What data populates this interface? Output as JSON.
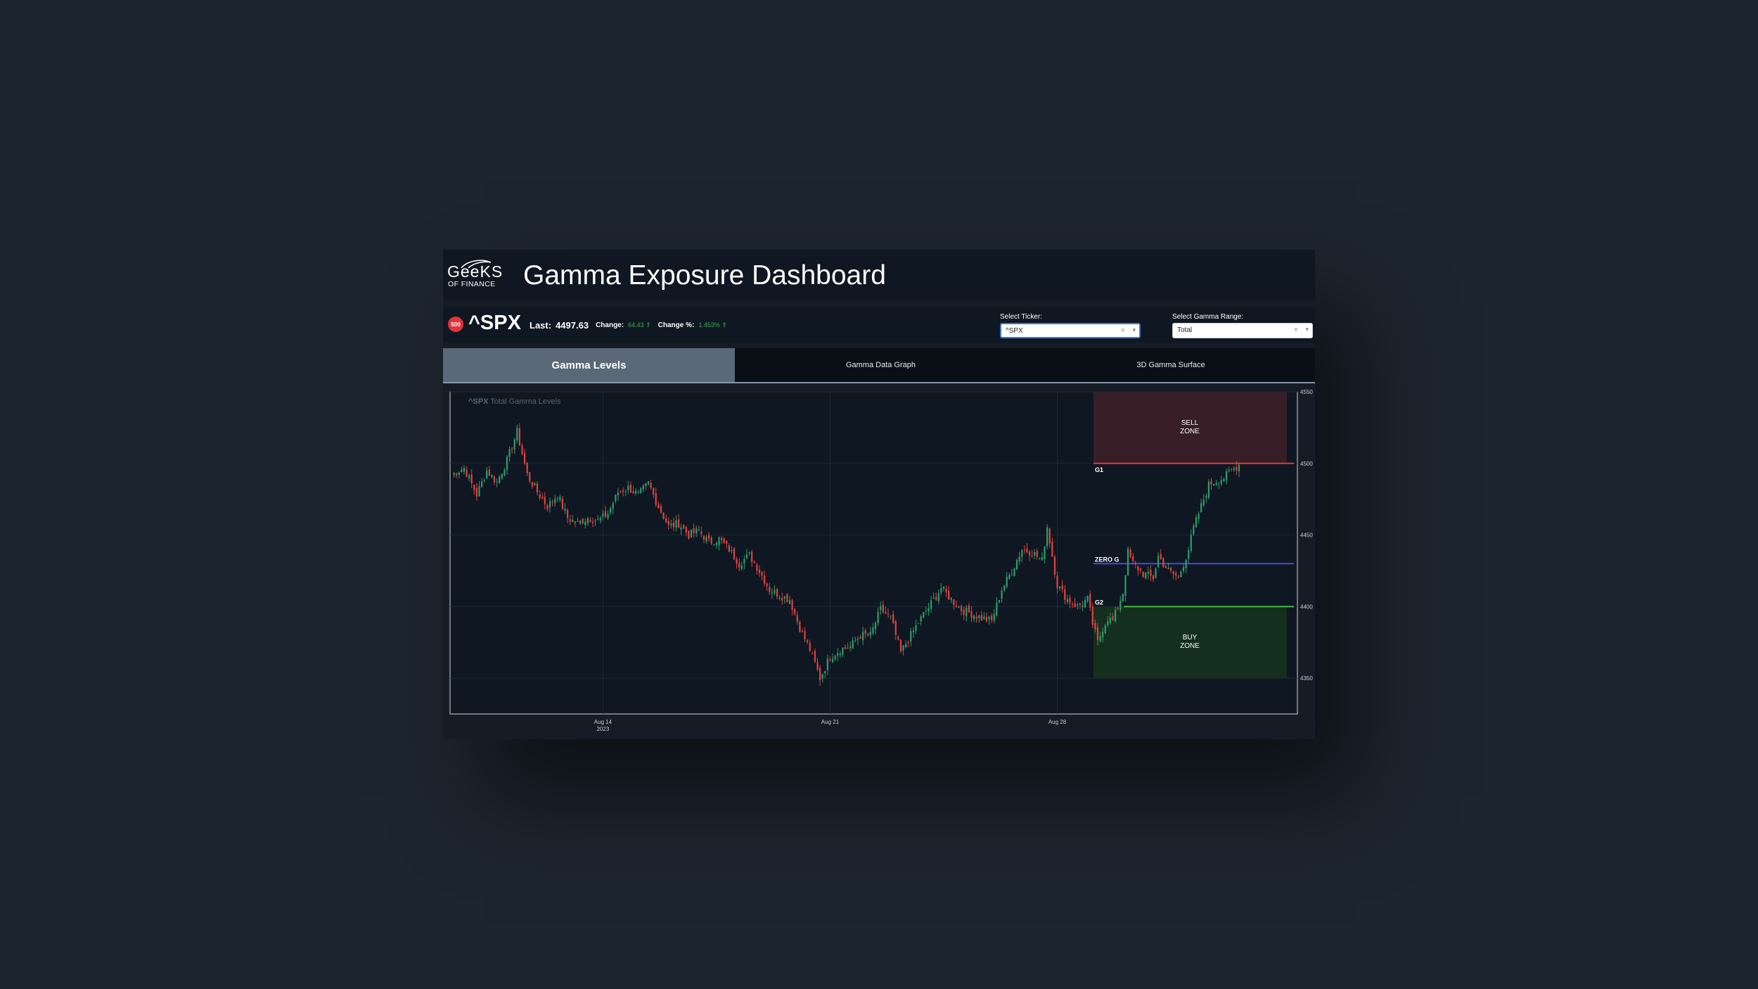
{
  "app": {
    "title": "Gamma Exposure Dashboard",
    "logo": {
      "main": "GeeKS",
      "sub": "OF FINANCE"
    }
  },
  "quote": {
    "badge": "500",
    "ticker": "^SPX",
    "last_label": "Last:",
    "last_value": "4497.63",
    "change_label": "Change:",
    "change_value": "64.43 ⇑",
    "change_pct_label": "Change %:",
    "change_pct_value": "1.453% ⇑",
    "positive_color": "#2db84d"
  },
  "controls": {
    "ticker_label": "Select Ticker:",
    "ticker_value": "^SPX",
    "gamma_label": "Select Gamma Range:",
    "gamma_value": "Total"
  },
  "tabs": [
    {
      "label": "Gamma Levels",
      "active": true
    },
    {
      "label": "Gamma Data Graph",
      "active": false
    },
    {
      "label": "3D Gamma Surface",
      "active": false
    }
  ],
  "chart_data": {
    "type": "candlestick",
    "title_bold": "^SPX",
    "title_rest": "Total Gamma Levels",
    "ylim": [
      4325,
      4550
    ],
    "y_ticks": [
      4350,
      4400,
      4450,
      4500,
      4550
    ],
    "x_ticks": [
      {
        "label": "Aug 14",
        "sub": "2023",
        "index": 60
      },
      {
        "label": "Aug 21",
        "sub": "",
        "index": 150
      },
      {
        "label": "Aug 28",
        "sub": "",
        "index": 240
      }
    ],
    "levels": [
      {
        "name": "G1",
        "value": 4500,
        "color": "#e03a3a"
      },
      {
        "name": "ZERO G",
        "value": 4430,
        "color": "#3f4fd8"
      },
      {
        "name": "G2",
        "value": 4400,
        "color": "#3fbf3f"
      }
    ],
    "zones": [
      {
        "label": [
          "SELL",
          "ZONE"
        ],
        "from": 4500,
        "to": 4550,
        "color": "#3a1f28"
      },
      {
        "label": [
          "BUY",
          "ZONE"
        ],
        "from": 4350,
        "to": 4400,
        "color": "#15301f"
      }
    ],
    "up_color": "#2e9c6a",
    "down_color": "#e0423e",
    "grid": true,
    "closes_anchor": [
      [
        0,
        4492
      ],
      [
        5,
        4497
      ],
      [
        10,
        4478
      ],
      [
        14,
        4495
      ],
      [
        18,
        4487
      ],
      [
        22,
        4502
      ],
      [
        26,
        4522
      ],
      [
        30,
        4492
      ],
      [
        34,
        4480
      ],
      [
        38,
        4470
      ],
      [
        42,
        4478
      ],
      [
        46,
        4462
      ],
      [
        50,
        4458
      ],
      [
        54,
        4462
      ],
      [
        58,
        4460
      ],
      [
        62,
        4465
      ],
      [
        66,
        4480
      ],
      [
        70,
        4483
      ],
      [
        74,
        4478
      ],
      [
        78,
        4486
      ],
      [
        82,
        4470
      ],
      [
        86,
        4456
      ],
      [
        90,
        4458
      ],
      [
        94,
        4450
      ],
      [
        98,
        4453
      ],
      [
        102,
        4445
      ],
      [
        106,
        4447
      ],
      [
        110,
        4440
      ],
      [
        114,
        4430
      ],
      [
        118,
        4436
      ],
      [
        122,
        4425
      ],
      [
        126,
        4412
      ],
      [
        130,
        4408
      ],
      [
        134,
        4405
      ],
      [
        138,
        4385
      ],
      [
        142,
        4370
      ],
      [
        146,
        4350
      ],
      [
        150,
        4365
      ],
      [
        154,
        4370
      ],
      [
        158,
        4372
      ],
      [
        162,
        4380
      ],
      [
        166,
        4380
      ],
      [
        170,
        4398
      ],
      [
        174,
        4392
      ],
      [
        178,
        4368
      ],
      [
        182,
        4380
      ],
      [
        186,
        4392
      ],
      [
        190,
        4402
      ],
      [
        194,
        4413
      ],
      [
        198,
        4405
      ],
      [
        202,
        4398
      ],
      [
        206,
        4395
      ],
      [
        210,
        4392
      ],
      [
        214,
        4390
      ],
      [
        218,
        4412
      ],
      [
        222,
        4425
      ],
      [
        226,
        4440
      ],
      [
        230,
        4438
      ],
      [
        234,
        4432
      ],
      [
        236,
        4456
      ],
      [
        240,
        4415
      ],
      [
        244,
        4405
      ],
      [
        248,
        4400
      ],
      [
        252,
        4405
      ],
      [
        254,
        4388
      ],
      [
        256,
        4375
      ],
      [
        258,
        4385
      ],
      [
        260,
        4392
      ],
      [
        262,
        4390
      ],
      [
        264,
        4400
      ],
      [
        266,
        4410
      ],
      [
        268,
        4438
      ],
      [
        270,
        4430
      ],
      [
        274,
        4423
      ],
      [
        278,
        4420
      ],
      [
        280,
        4435
      ],
      [
        284,
        4425
      ],
      [
        288,
        4420
      ],
      [
        292,
        4440
      ],
      [
        294,
        4455
      ],
      [
        296,
        4465
      ],
      [
        298,
        4475
      ],
      [
        300,
        4485
      ],
      [
        303,
        4488
      ],
      [
        306,
        4490
      ],
      [
        309,
        4495
      ],
      [
        312,
        4499
      ]
    ]
  }
}
